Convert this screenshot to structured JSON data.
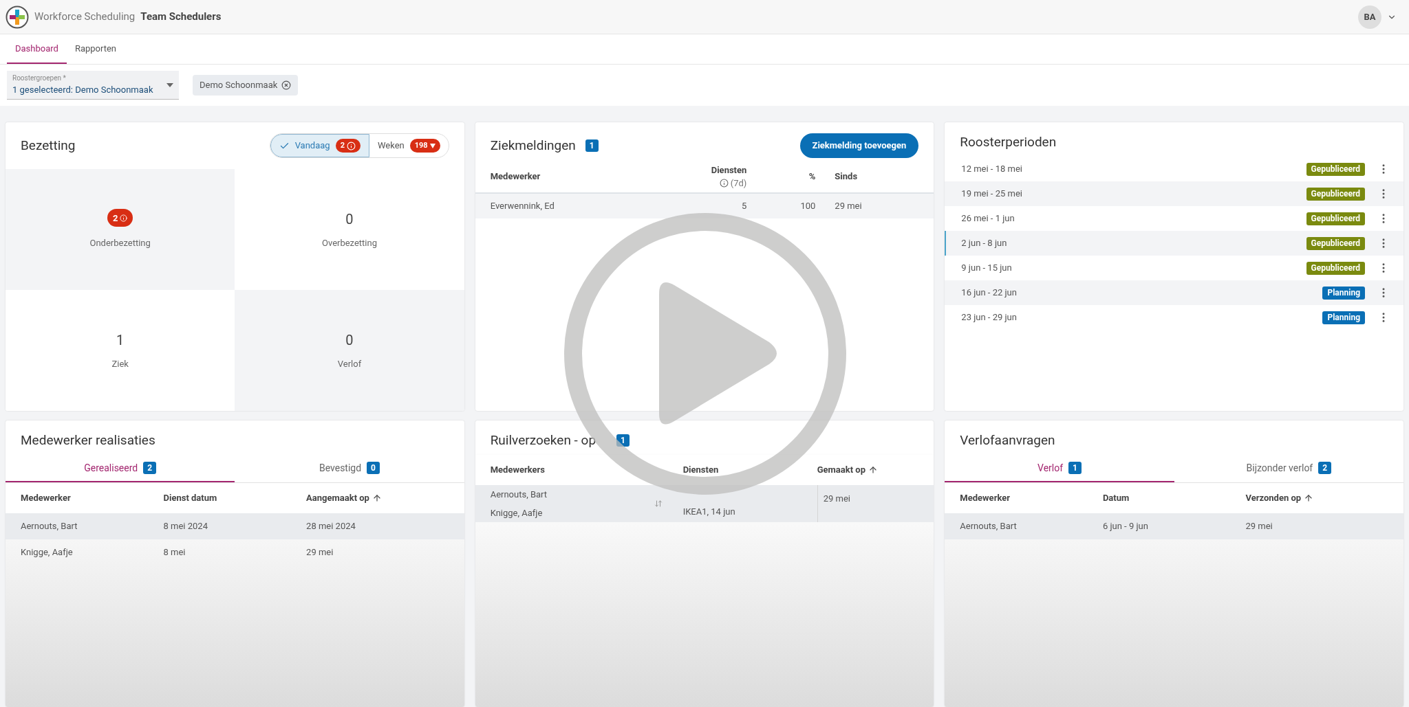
{
  "header": {
    "app_name": "Workforce Scheduling",
    "team": "Team Schedulers",
    "avatar": "BA"
  },
  "tabs": [
    {
      "label": "Dashboard",
      "selected": true
    },
    {
      "label": "Rapporten",
      "selected": false
    }
  ],
  "filter": {
    "label": "Roostergroepen *",
    "value": "1 geselecteerd: Demo Schoonmaak",
    "chips": [
      "Demo Schoonmaak"
    ]
  },
  "bezetting": {
    "title": "Bezetting",
    "toggle": [
      {
        "label": "Vandaag",
        "selected": true,
        "badge": "2",
        "kind": "info"
      },
      {
        "label": "Weken",
        "selected": false,
        "badge": "198",
        "kind": "down"
      }
    ],
    "tiles": [
      {
        "kind": "badge",
        "value": "2",
        "label": "Onderbezetting"
      },
      {
        "kind": "number",
        "value": "0",
        "label": "Overbezetting"
      },
      {
        "kind": "number",
        "value": "1",
        "label": "Ziek"
      },
      {
        "kind": "number",
        "value": "0",
        "label": "Verlof"
      }
    ]
  },
  "ziekmeldingen": {
    "title": "Ziekmeldingen",
    "count": "1",
    "button": "Ziekmelding toevoegen",
    "columns": [
      "Medewerker",
      "Diensten",
      "%",
      "Sinds"
    ],
    "diensten_sub": "(7d)",
    "rows": [
      {
        "medewerker": "Everwennink, Ed",
        "diensten": "5",
        "percent": "100",
        "sinds": "29 mei"
      }
    ]
  },
  "roosterperioden": {
    "title": "Roosterperioden",
    "rows": [
      {
        "label": "12 mei - 18 mei",
        "status": "Gepubliceerd",
        "kind": "published",
        "selected": false
      },
      {
        "label": "19 mei - 25 mei",
        "status": "Gepubliceerd",
        "kind": "published",
        "selected": false
      },
      {
        "label": "26 mei - 1 jun",
        "status": "Gepubliceerd",
        "kind": "published",
        "selected": false
      },
      {
        "label": "2 jun - 8 jun",
        "status": "Gepubliceerd",
        "kind": "published",
        "selected": true
      },
      {
        "label": "9 jun - 15 jun",
        "status": "Gepubliceerd",
        "kind": "published",
        "selected": false
      },
      {
        "label": "16 jun - 22 jun",
        "status": "Planning",
        "kind": "planning",
        "selected": false
      },
      {
        "label": "23 jun - 29 jun",
        "status": "Planning",
        "kind": "planning",
        "selected": false
      }
    ]
  },
  "realisaties": {
    "title": "Medewerker realisaties",
    "tabs": [
      {
        "label": "Gerealiseerd",
        "count": "2",
        "selected": true
      },
      {
        "label": "Bevestigd",
        "count": "0",
        "selected": false
      }
    ],
    "columns": [
      {
        "label": "Medewerker",
        "sorted": false
      },
      {
        "label": "Dienst datum",
        "sorted": false
      },
      {
        "label": "Aangemaakt op",
        "sorted": true
      }
    ],
    "rows": [
      [
        "Aernouts, Bart",
        "8 mei 2024",
        "28 mei 2024"
      ],
      [
        "Knigge, Aafje",
        "8 mei",
        "29 mei"
      ]
    ]
  },
  "ruilverzoeken": {
    "title": "Ruilverzoeken - op",
    "count": "1",
    "columns": [
      {
        "label": "Medewerkers",
        "sorted": false
      },
      {
        "label": "Diensten",
        "sorted": false
      },
      {
        "label": "Gemaakt op",
        "sorted": true
      }
    ],
    "rows": [
      {
        "medewerkers": [
          "Aernouts, Bart",
          "Knigge, Aafje"
        ],
        "diensten": "IKEA1, 14 jun",
        "gemaakt": "29 mei"
      }
    ]
  },
  "verlofaanvragen": {
    "title": "Verlofaanvragen",
    "tabs": [
      {
        "label": "Verlof",
        "count": "1",
        "selected": true
      },
      {
        "label": "Bijzonder verlof",
        "count": "2",
        "selected": false
      }
    ],
    "columns": [
      {
        "label": "Medewerker",
        "sorted": false
      },
      {
        "label": "Datum",
        "sorted": false
      },
      {
        "label": "Verzonden op",
        "sorted": true
      }
    ],
    "rows": [
      [
        "Aernouts, Bart",
        "6 jun - 9 jun",
        "29 mei"
      ]
    ]
  }
}
